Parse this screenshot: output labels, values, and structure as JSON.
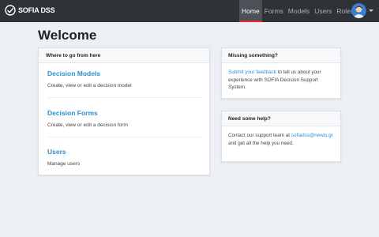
{
  "navbar": {
    "brand": "SOFIA DSS",
    "links": [
      "Home",
      "Forms",
      "Models",
      "Users",
      "Roles"
    ],
    "active_index": 0
  },
  "page": {
    "title": "Welcome"
  },
  "main_card": {
    "header": "Where to go from here",
    "items": [
      {
        "title": "Decision Models",
        "description": "Create, view or edit a decision model"
      },
      {
        "title": "Decision Forms",
        "description": "Create, view or edit a decision form"
      },
      {
        "title": "Users",
        "description": "Manage users"
      }
    ]
  },
  "missing_card": {
    "header": "Missing something?",
    "link_text": "Submit your feedback",
    "body_text": " to tell us about your experience with SOFIA Decision Support System."
  },
  "help_card": {
    "header": "Need some help?",
    "text_before": "Contact our support team at ",
    "email": "sofiadss@newis.gr",
    "text_after": " and get all the help you need."
  },
  "colors": {
    "accent": "#2a8fd1",
    "navbar": "#2f3237",
    "active_underline": "#e02a2a"
  },
  "icons": {
    "brand": "sofia-logo-icon",
    "avatar": "user-avatar-icon",
    "menu": "caret-down-icon"
  }
}
